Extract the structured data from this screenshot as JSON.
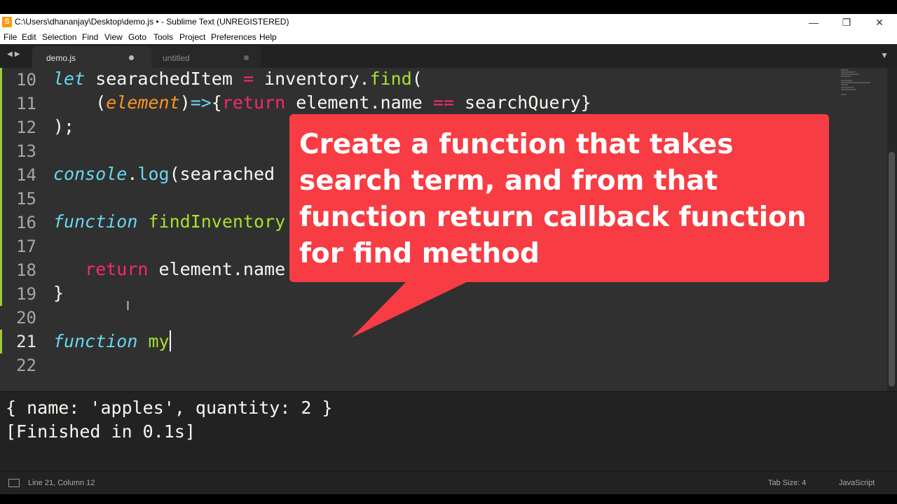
{
  "window": {
    "title": "C:\\Users\\dhananjay\\Desktop\\demo.js • - Sublime Text (UNREGISTERED)",
    "app_icon": "S"
  },
  "menu": [
    "File",
    "Edit",
    "Selection",
    "Find",
    "View",
    "Goto",
    "Tools",
    "Project",
    "Preferences",
    "Help"
  ],
  "tabs": [
    {
      "label": "demo.js",
      "active": true,
      "modified": true
    },
    {
      "label": "untitled",
      "active": false,
      "modified": true
    }
  ],
  "editor": {
    "line_numbers": [
      "10",
      "11",
      "12",
      "13",
      "14",
      "15",
      "16",
      "17",
      "18",
      "19",
      "20",
      "21",
      "22"
    ],
    "current_line": "21",
    "code": {
      "l10_kw": "let",
      "l10_var": " searachedItem ",
      "l10_eq": "=",
      "l10_obj": " inventory.",
      "l10_fn": "find",
      "l10_paren": "(",
      "l11_open": "    (",
      "l11_arg": "element",
      "l11_close": ")",
      "l11_arrow": "=>",
      "l11_brace": "{",
      "l11_return": "return",
      "l11_expr": " element.name ",
      "l11_eqeq": "==",
      "l11_query": " searchQuery}",
      "l12": ");",
      "l14_obj": "console",
      "l14_dot": ".",
      "l14_fn": "log",
      "l14_rest": "(searached",
      "l16_kw": "function",
      "l16_space": " ",
      "l16_name": "findInventory",
      "l18_indent": "   ",
      "l18_return": "return",
      "l18_rest": " element.name",
      "l19": "}",
      "l21_kw": "function",
      "l21_space": " ",
      "l21_name": "my"
    }
  },
  "callout": {
    "text": "Create a function that takes search term, and from that function return callback function for find method",
    "color": "#f83c43"
  },
  "console": {
    "lines": [
      "{ name: 'apples', quantity: 2 }",
      "[Finished in 0.1s]"
    ]
  },
  "status": {
    "position": "Line 21, Column 12",
    "tab_size": "Tab Size: 4",
    "syntax": "JavaScript"
  },
  "colors": {
    "keyword": "#66d9ef",
    "function": "#a6e22e",
    "operator": "#f92672",
    "argument": "#fd971f",
    "editor_bg": "#303030"
  }
}
